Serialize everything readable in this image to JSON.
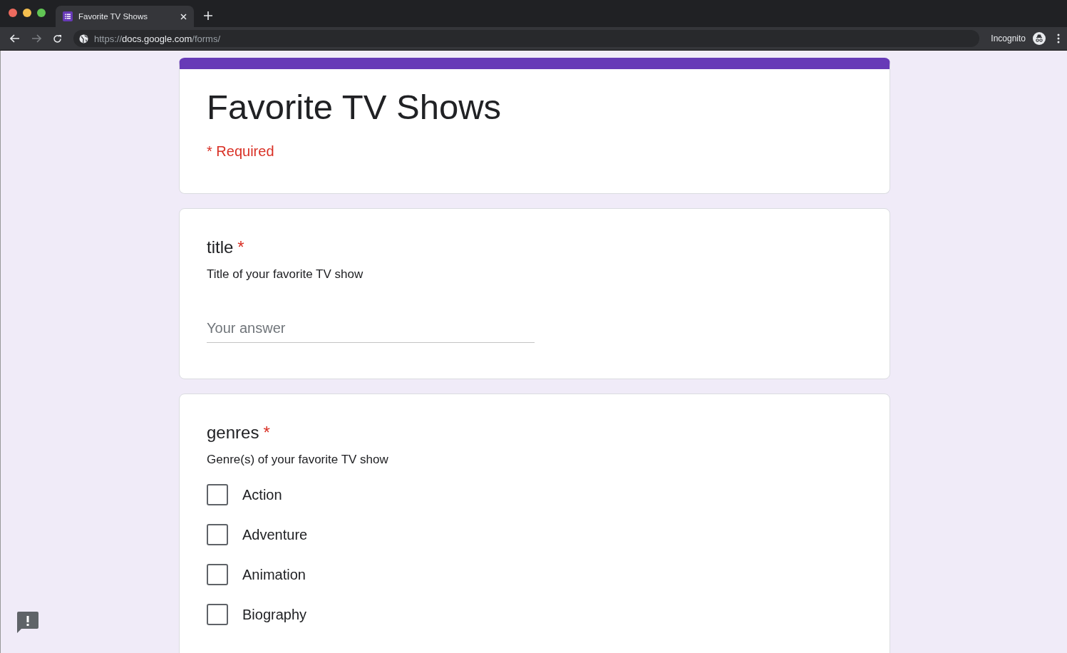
{
  "browser": {
    "tab": {
      "title": "Favorite TV Shows",
      "selected": true
    },
    "url": {
      "scheme": "https://",
      "host": "docs.google.com",
      "path": "/forms/"
    },
    "profile": "Incognito"
  },
  "form": {
    "title": "Favorite TV Shows",
    "required_note": "* Required"
  },
  "questions": [
    {
      "kind": "text",
      "title": "title",
      "required_mark": "*",
      "description": "Title of your favorite TV show",
      "placeholder": "Your answer"
    },
    {
      "kind": "checkbox",
      "title": "genres",
      "required_mark": "*",
      "description": "Genre(s) of your favorite TV show",
      "options": [
        {
          "label": "Action",
          "checked": false
        },
        {
          "label": "Adventure",
          "checked": false
        },
        {
          "label": "Animation",
          "checked": false
        },
        {
          "label": "Biography",
          "checked": false
        }
      ]
    }
  ]
}
